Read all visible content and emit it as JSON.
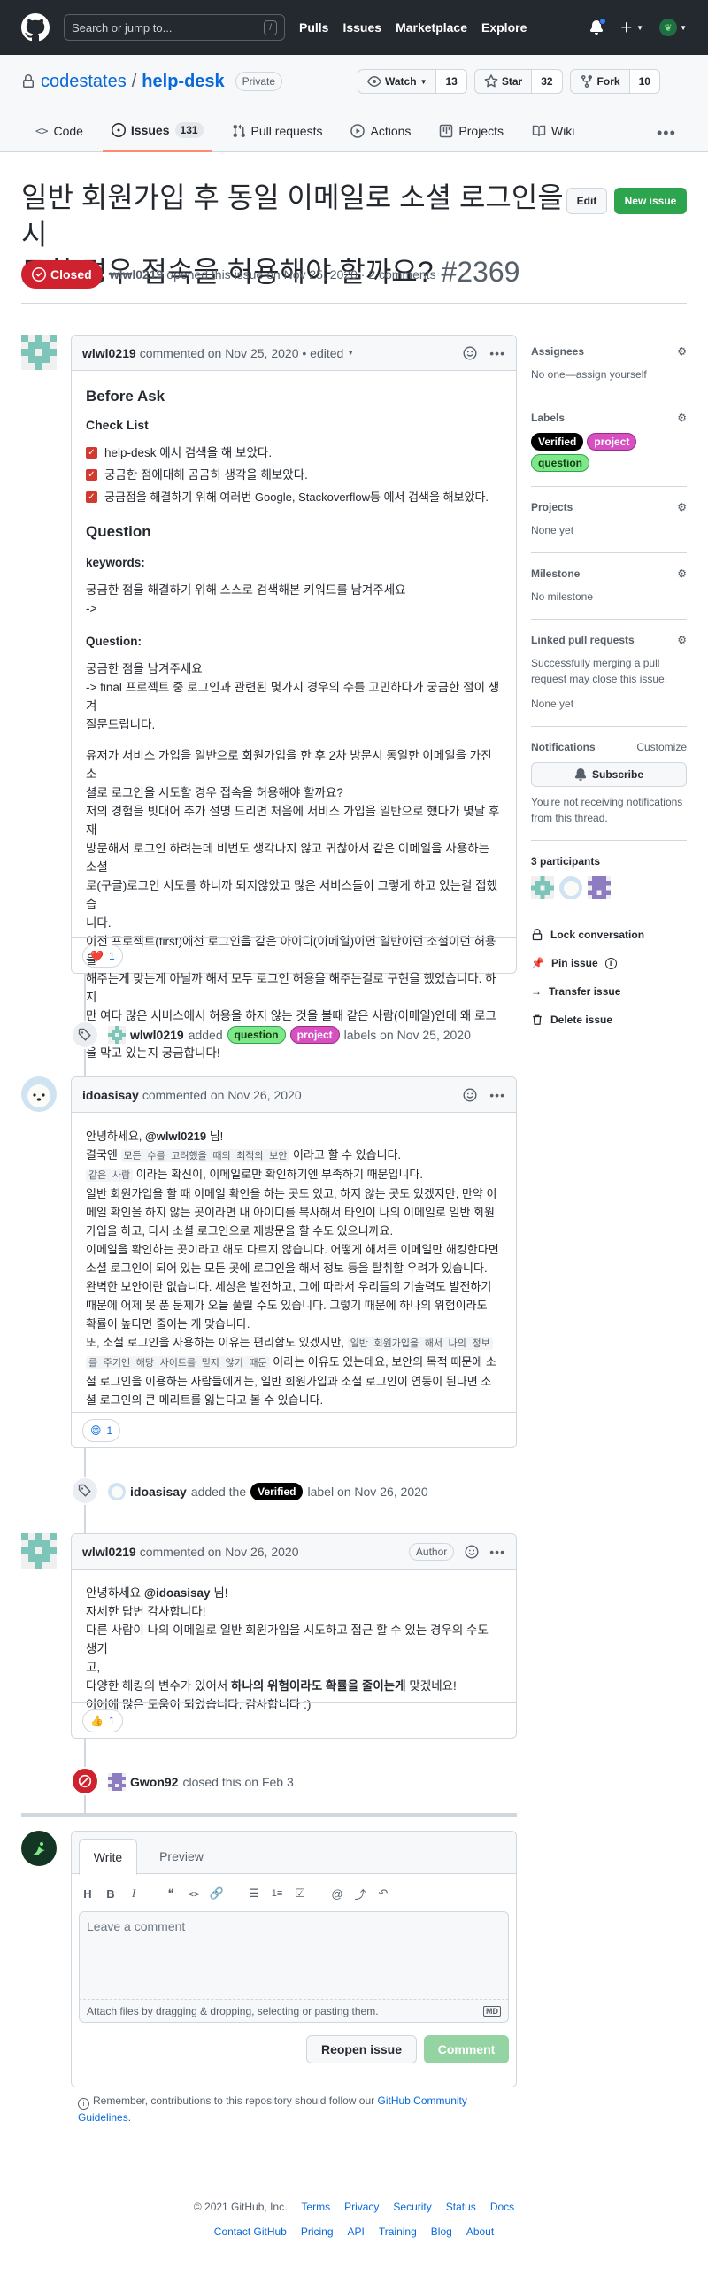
{
  "header": {
    "search_placeholder": "Search or jump to...",
    "search_key": "/",
    "nav": [
      "Pulls",
      "Issues",
      "Marketplace",
      "Explore"
    ]
  },
  "repo": {
    "owner": "codestates",
    "separator": "/",
    "name": "help-desk",
    "visibility": "Private",
    "watch_label": "Watch",
    "watch_count": "13",
    "star_label": "Star",
    "star_count": "32",
    "fork_label": "Fork",
    "fork_count": "10"
  },
  "tabs": {
    "code": "Code",
    "issues": "Issues",
    "issues_count": "131",
    "pulls": "Pull requests",
    "actions": "Actions",
    "projects": "Projects",
    "wiki": "Wiki"
  },
  "issue": {
    "title_line1": "일반 회원가입 후 동일 이메일로 소셜 로그인을 시",
    "title_line2": "도할 경우 접속을 허용해야 할까요?",
    "number": "#2369",
    "edit_button": "Edit",
    "new_issue_button": "New issue",
    "state": "Closed",
    "author": "wlwl0219",
    "meta": "opened this issue on Nov 25, 2020 · 2 comments"
  },
  "comment1": {
    "author": "wlwl0219",
    "meta": "commented on Nov 25, 2020",
    "edited": "• edited",
    "h_before": "Before Ask",
    "h_checklist": "Check List",
    "checks": [
      "help-desk 에서 검색을 해 보았다.",
      "궁금한 점에대해 곰곰히 생각을 해보았다.",
      "궁금점을 해결하기 위해 여러번 Google, Stackoverflow등 에서 검색을 해보았다."
    ],
    "h_question": "Question",
    "h_keywords": "keywords:",
    "keywords_text1": "궁금한 점을 해결하기 위해 스스로 검색해본 키워드를 남겨주세요",
    "keywords_text2": "->",
    "h_question2": "Question:",
    "q1": "궁금한 점을 남겨주세요",
    "q2": "-> final 프로젝트 중 로그인과 관련된 몇가지 경우의 수를 고민하다가 궁금한 점이 생겨",
    "q3": "질문드립니다.",
    "p1_1": "유저가 서비스 가입을 일반으로 회원가입을 한 후 2차 방문시 동일한 이메일을 가진 소",
    "p1_2": "셜로 로그인을 시도할 경우 접속을 허용해야 할까요?",
    "p1_3": "저의 경험을 빗대어 추가 설명 드리면 처음에 서비스 가입을 일반으로 했다가 몇달 후 재",
    "p1_4": "방문해서 로그인 하려는데 비번도 생각나지 않고 귀찮아서 같은 이메일을 사용하는 소셜",
    "p1_5": "로(구글)로그인 시도를 하니까 되지않았고 많은 서비스들이 그렇게 하고 있는걸 접했습",
    "p1_6": "니다.",
    "p2_1": "이전 프로젝트(first)에선 로그인을 같은 아이디(이메일)이면 일반이던 소셜이던 허용을",
    "p2_2": "해주는게 맞는게 아닐까 해서 모두 로그인 허용을 해주는걸로 구현을 했었습니다. 하지",
    "p2_3": "만 여타 많은 서비스에서 허용을 하지 않는 것을 볼때 같은 사람(이메일)인데 왜 로그인",
    "p2_4": "을 막고 있는지 궁금합니다!",
    "reaction_emoji": "❤️",
    "reaction_count": "1"
  },
  "event_labels": {
    "actor": "wlwl0219",
    "added": "added",
    "label1": "question",
    "label2": "project",
    "suffix": "labels on Nov 25, 2020"
  },
  "comment2": {
    "author": "idoasisay",
    "meta": "commented on Nov 26, 2020",
    "l1a": "안녕하세요, ",
    "l1b": "@wlwl0219",
    "l1c": " 님!",
    "l2a": "결국엔 ",
    "l2k": "모든 수를 고려했을 때의 최적의 보안",
    "l2b": " 이라고 할 수 있습니다.",
    "l3k": "같은 사람",
    "l3b": " 이라는 확신이, 이메일로만 확인하기엔 부족하기 때문입니다.",
    "l4": "일반 회원가입을 할 때 이메일 확인을 하는 곳도 있고, 하지 않는 곳도 있겠지만, 만약 이",
    "l5": "메일 확인을 하지 않는 곳이라면 내 아이디를 복사해서 타인이 나의 이메일로 일반 회원",
    "l6": "가입을 하고, 다시 소셜 로그인으로 재방문을 할 수도 있으니까요.",
    "l7": "이메일을 확인하는 곳이라고 해도 다르지 않습니다. 어떻게 해서든 이메일만 해킹한다면",
    "l8": "소셜 로그인이 되어 있는 모든 곳에 로그인을 해서 정보 등을 탈취할 우려가 있습니다.",
    "l9": "완벽한 보안이란 없습니다. 세상은 발전하고, 그에 따라서 우리들의 기술력도 발전하기",
    "l10": "때문에 어제 못 푼 문제가 오늘 풀릴 수도 있습니다. 그렇기 때문에 하나의 위험이라도",
    "l11": "확률이 높다면 줄이는 게 맞습니다.",
    "l12a": "또, 소셜 로그인을 사용하는 이유는 편리함도 있겠지만, ",
    "l12k": "일반 회원가입을 해서 나의 정보",
    "l13k": "를 주기엔 해당 사이트를 믿지 않기 때문",
    "l13b": " 이라는 이유도 있는데요, 보안의 목적 때문에 소",
    "l14": "셜 로그인을 이용하는 사람들에게는, 일반 회원가입과 소셜 로그인이 연동이 된다면 소",
    "l15": "셜 로그인의 큰 메리트를 잃는다고 볼 수 있습니다.",
    "reaction_emoji": "😄",
    "reaction_count": "1"
  },
  "event_verified": {
    "actor": "idoasisay",
    "added": "added the",
    "label": "Verified",
    "suffix": "label on Nov 26, 2020"
  },
  "comment3": {
    "author": "wlwl0219",
    "meta": "commented on Nov 26, 2020",
    "badge": "Author",
    "l1a": "안녕하세요 ",
    "l1b": "@idoasisay",
    "l1c": " 님!",
    "l2": "자세한 답변 감사합니다!",
    "l3": "다른 사람이 나의 이메일로 일반 회원가입을 시도하고 접근 할 수 있는 경우의 수도 생기",
    "l4": "고,",
    "l5a": "다양한 해킹의 변수가 있어서 ",
    "l5b": "하나의 위험이라도 확률을 줄이는게",
    "l5c": " 맞겠네요!",
    "l6": "이에에 많은 도움이 되었습니다. 감사합니다 :)",
    "reaction_emoji": "👍",
    "reaction_count": "1"
  },
  "event_closed": {
    "actor": "Gwon92",
    "text": "closed this on Feb 3"
  },
  "composer": {
    "tab_write": "Write",
    "tab_preview": "Preview",
    "placeholder": "Leave a comment",
    "attach": "Attach files by dragging & dropping, selecting or pasting them.",
    "md": "MD",
    "reopen": "Reopen issue",
    "comment": "Comment",
    "note_pre": "Remember, contributions to this repository should follow our ",
    "note_link1": "GitHub Community",
    "note_link2": "Guidelines",
    "note_post": "."
  },
  "sidebar": {
    "assignees": "Assignees",
    "assignees_text": "No one—assign yourself",
    "labels": "Labels",
    "label_verified": "Verified",
    "label_project": "project",
    "label_question": "question",
    "projects": "Projects",
    "projects_text": "None yet",
    "milestone": "Milestone",
    "milestone_text": "No milestone",
    "linked": "Linked pull requests",
    "linked_text1": "Successfully merging a pull",
    "linked_text2": "request may close this issue.",
    "linked_none": "None yet",
    "notifications": "Notifications",
    "customize": "Customize",
    "subscribe": "Subscribe",
    "notif_text1": "You're not receiving notifications",
    "notif_text2": "from this thread.",
    "participants": "3 participants",
    "lock": "Lock conversation",
    "pin": "Pin issue",
    "transfer": "Transfer issue",
    "delete": "Delete issue"
  },
  "footer": {
    "copyright": "© 2021 GitHub, Inc.",
    "row1": [
      "Terms",
      "Privacy",
      "Security",
      "Status",
      "Docs"
    ],
    "row2": [
      "Contact GitHub",
      "Pricing",
      "API",
      "Training",
      "Blog",
      "About"
    ]
  },
  "colors": {
    "closed": "#cf222e",
    "green": "#2da44e",
    "header_bg": "#24292f",
    "link": "#0969da",
    "tab_underline": "#fd8c73"
  }
}
